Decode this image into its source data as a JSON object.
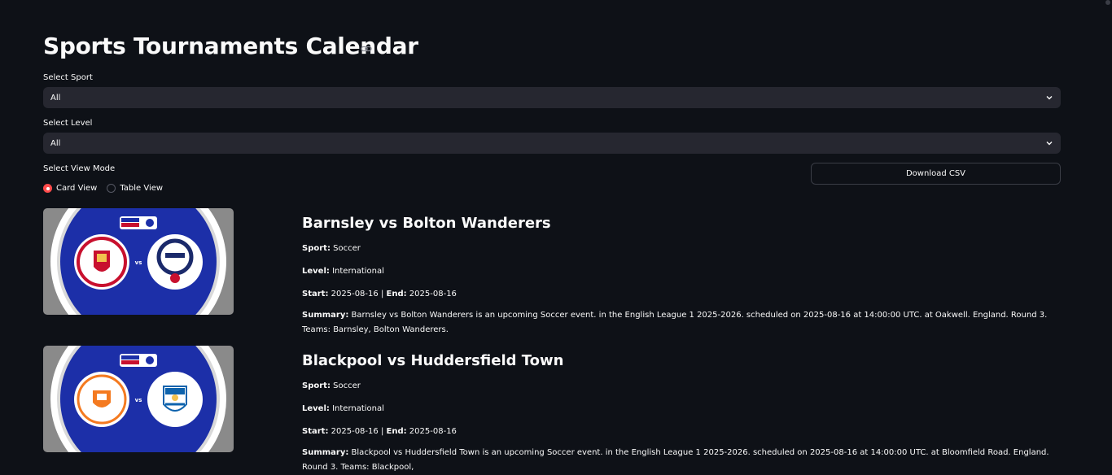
{
  "page": {
    "title": "Sports Tournaments Calendar"
  },
  "filters": {
    "sport_label": "Select Sport",
    "sport_value": "All",
    "level_label": "Select Level",
    "level_value": "All",
    "view_label": "Select View Mode",
    "view_options": [
      "Card View",
      "Table View"
    ],
    "view_selected": "Card View",
    "download_label": "Download CSV"
  },
  "field_labels": {
    "sport": "Sport:",
    "level": "Level:",
    "start": "Start:",
    "end": "End:",
    "summary": "Summary:"
  },
  "events": [
    {
      "title": "Barnsley vs Bolton Wanderers",
      "sport": "Soccer",
      "level": "International",
      "start": "2025-08-16",
      "end": "2025-08-16",
      "summary": "Barnsley vs Bolton Wanderers is an upcoming Soccer event. in the English League 1 2025-2026. scheduled on 2025-08-16 at 14:00:00 UTC. at Oakwell. England. Round 3. Teams: Barnsley, Bolton Wanderers.",
      "badge_text": "vs",
      "home_color": "#c8102e",
      "away_color": "#1b2a6b"
    },
    {
      "title": "Blackpool vs Huddersfield Town",
      "sport": "Soccer",
      "level": "International",
      "start": "2025-08-16",
      "end": "2025-08-16",
      "summary": "Blackpool vs Huddersfield Town is an upcoming Soccer event. in the English League 1 2025-2026. scheduled on 2025-08-16 at 14:00:00 UTC. at Bloomfield Road. England. Round 3. Teams: Blackpool,",
      "badge_text": "vs",
      "home_color": "#f47a20",
      "away_color": "#0e63ad"
    }
  ],
  "colors": {
    "background": "#0e1117",
    "select_bg": "#262730",
    "accent": "#ff4b4b",
    "thumb_blue": "#1c2fa8",
    "thumb_grey": "#8a8a8a"
  }
}
